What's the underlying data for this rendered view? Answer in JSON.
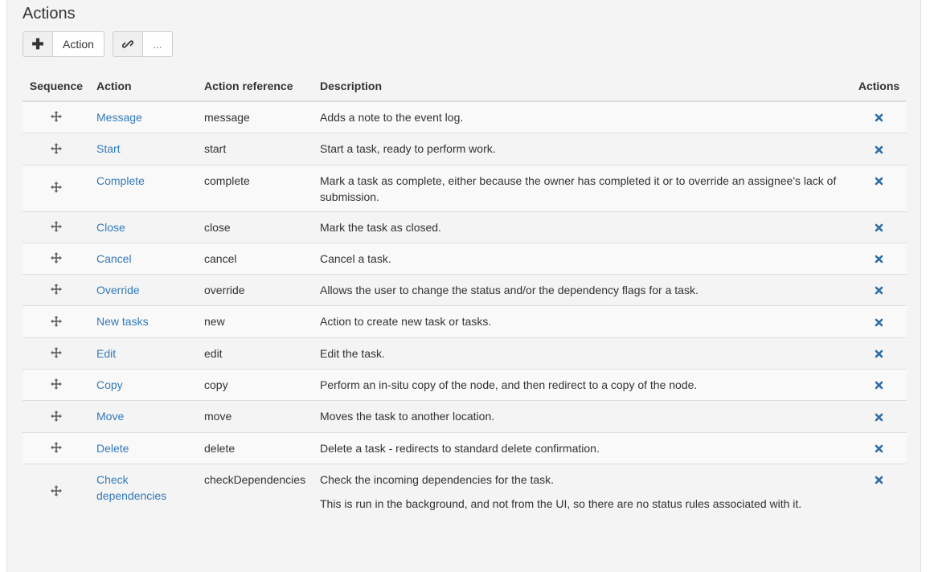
{
  "section": {
    "title": "Actions"
  },
  "toolbar": {
    "add_label": "Action",
    "more_label": "..."
  },
  "table": {
    "headers": {
      "sequence": "Sequence",
      "action": "Action",
      "reference": "Action reference",
      "description": "Description",
      "actions": "Actions"
    },
    "rows": [
      {
        "name": "Message",
        "reference": "message",
        "description": [
          "Adds a note to the event log."
        ]
      },
      {
        "name": "Start",
        "reference": "start",
        "description": [
          "Start a task, ready to perform work."
        ]
      },
      {
        "name": "Complete",
        "reference": "complete",
        "description": [
          "Mark a task as complete, either because the owner has completed it or to override an assignee's lack of submission."
        ]
      },
      {
        "name": "Close",
        "reference": "close",
        "description": [
          "Mark the task as closed."
        ]
      },
      {
        "name": "Cancel",
        "reference": "cancel",
        "description": [
          "Cancel a task."
        ]
      },
      {
        "name": "Override",
        "reference": "override",
        "description": [
          "Allows the user to change the status and/or the dependency flags for a task."
        ]
      },
      {
        "name": "New tasks",
        "reference": "new",
        "description": [
          "Action to create new task or tasks."
        ]
      },
      {
        "name": "Edit",
        "reference": "edit",
        "description": [
          "Edit the task."
        ]
      },
      {
        "name": "Copy",
        "reference": "copy",
        "description": [
          "Perform an in-situ copy of the node, and then redirect to a copy of the node."
        ]
      },
      {
        "name": "Move",
        "reference": "move",
        "description": [
          "Moves the task to another location."
        ]
      },
      {
        "name": "Delete",
        "reference": "delete",
        "description": [
          "Delete a task - redirects to standard delete confirmation."
        ]
      },
      {
        "name": "Check dependencies",
        "reference": "checkDependencies",
        "description": [
          "Check the incoming dependencies for the task.",
          "This is run in the background, and not from the UI, so there are no status rules associated with it."
        ]
      }
    ]
  },
  "icons": {
    "add": "plus-icon",
    "link": "link-icon",
    "drag": "move-arrows-icon",
    "remove": "remove-x-icon"
  },
  "colors": {
    "link": "#337ab7",
    "drag_icon": "#666666"
  }
}
